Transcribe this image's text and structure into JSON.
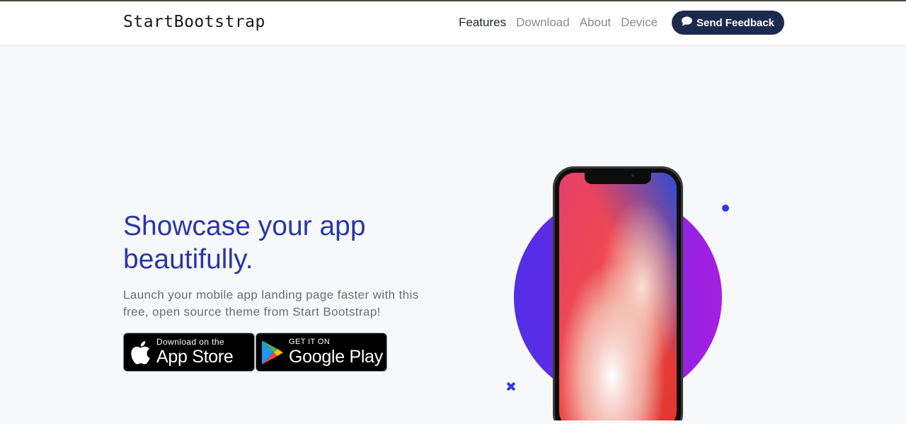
{
  "navbar": {
    "brand": "StartBootstrap",
    "links": [
      {
        "label": "Features",
        "active": true
      },
      {
        "label": "Download",
        "active": false
      },
      {
        "label": "About",
        "active": false
      },
      {
        "label": "Device",
        "active": false
      }
    ],
    "feedback_label": "Send Feedback"
  },
  "hero": {
    "title": "Showcase your app beautifully.",
    "lead": "Launch your mobile app landing page faster with this free, open source theme from Start Bootstrap!",
    "app_store": {
      "small": "Download on the",
      "big": "App Store"
    },
    "google_play": {
      "small": "GET IT ON",
      "big": "Google Play"
    }
  },
  "colors": {
    "accent": "#2837a8",
    "button_dark": "#1c2a4d",
    "circle_start": "#4f2ee8",
    "circle_end": "#a51fe0"
  },
  "icons": [
    "chat-icon",
    "apple-icon",
    "google-play-icon",
    "phone-mockup"
  ]
}
